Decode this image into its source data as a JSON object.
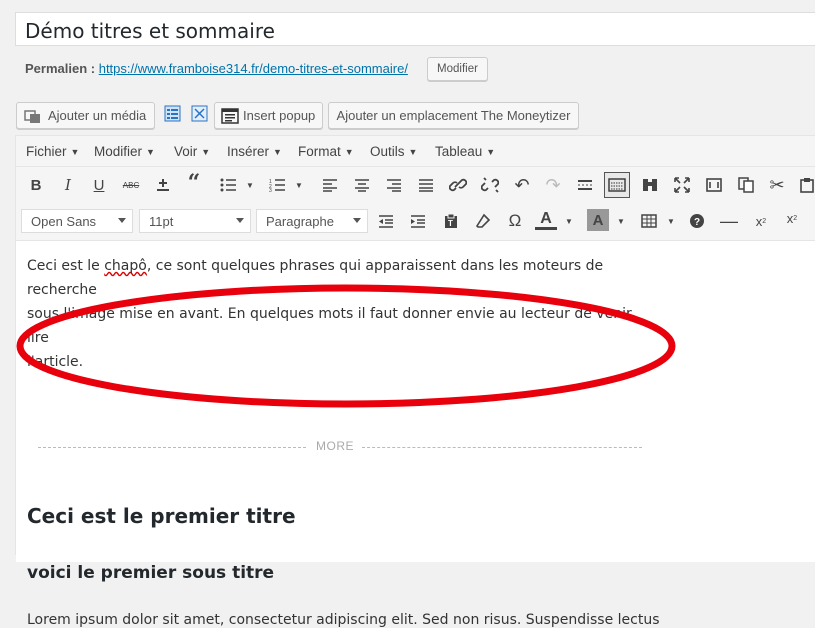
{
  "post": {
    "title": "Démo titres et sommaire",
    "permalink_label": "Permalien :",
    "permalink_url": "https://www.framboise314.fr/demo-titres-et-sommaire/",
    "modify_button": "Modifier"
  },
  "media_buttons": {
    "add_media": "Ajouter un média",
    "insert_popup": "Insert popup",
    "moneytizer": "Ajouter un emplacement The Moneytizer"
  },
  "menubar": [
    "Fichier",
    "Modifier",
    "Voir",
    "Insérer",
    "Format",
    "Outils",
    "Tableau"
  ],
  "toolbar2": {
    "font_family": "Open Sans",
    "font_size": "11pt",
    "block_format": "Paragraphe"
  },
  "content": {
    "chapo_line1_pre": "Ceci est le ",
    "chapo_word": "chapô",
    "chapo_line1_post": ", ce sont quelques phrases qui apparaissent dans les moteurs de recherche",
    "chapo_line2": "sous l'image mise en avant. En quelques mots il faut donner envie au lecteur de venir lire",
    "chapo_line3": "l'article.",
    "more_tag": "MORE",
    "heading1": "Ceci est le premier titre",
    "heading2": "voici le premier sous titre",
    "lorem": "Lorem ipsum dolor sit amet, consectetur adipiscing elit. Sed non risus. Suspendisse lectus"
  },
  "colors": {
    "annotation": "#e8000d",
    "link": "#0073aa"
  },
  "icons": [
    "bold-icon",
    "italic-icon",
    "underline-icon",
    "strikethrough-icon",
    "insert-icon",
    "blockquote-icon",
    "bullet-list-icon",
    "numbered-list-icon",
    "align-left-icon",
    "align-center-icon",
    "align-right-icon",
    "justify-icon",
    "link-icon",
    "unlink-icon",
    "undo-icon",
    "redo-icon",
    "read-more-icon",
    "toolbar-toggle-icon",
    "find-icon",
    "fullscreen-icon",
    "media-icon",
    "copy-icon",
    "cut-icon",
    "paste-icon"
  ]
}
